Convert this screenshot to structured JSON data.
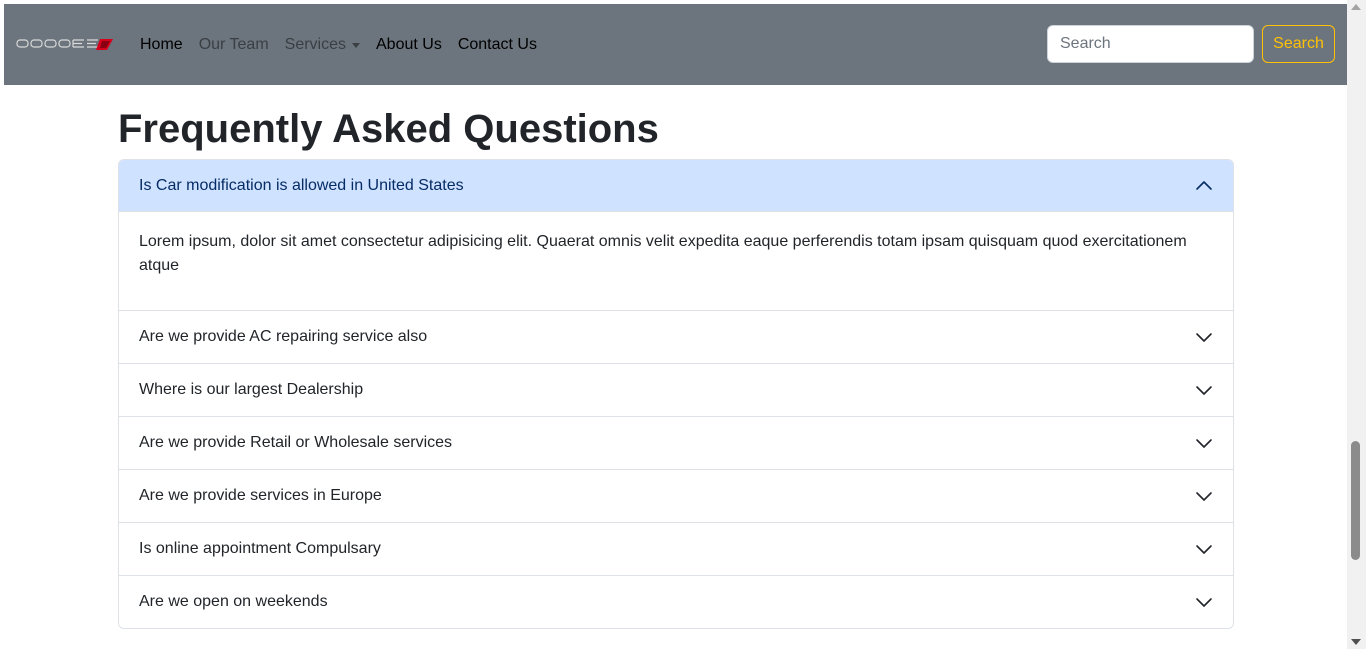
{
  "brand": {
    "logo_text": "DODGE",
    "accent_color": "#d6001c"
  },
  "nav": {
    "links": [
      {
        "label": "Home"
      },
      {
        "label": "Our Team"
      },
      {
        "label": "Services"
      },
      {
        "label": "About Us"
      },
      {
        "label": "Contact Us"
      }
    ]
  },
  "search": {
    "placeholder": "Search",
    "value": "",
    "button_label": "Search"
  },
  "page": {
    "title": "Frequently Asked Questions"
  },
  "faq": {
    "items": [
      {
        "question": "Is Car modification is allowed in United States",
        "answer": "Lorem ipsum, dolor sit amet consectetur adipisicing elit. Quaerat omnis velit expedita eaque perferendis totam ipsam quisquam quod exercitationem atque",
        "expanded": true
      },
      {
        "question": "Are we provide AC repairing service also",
        "expanded": false
      },
      {
        "question": "Where is our largest Dealership",
        "expanded": false
      },
      {
        "question": "Are we provide Retail or Wholesale services",
        "expanded": false
      },
      {
        "question": "Are we provide services in Europe",
        "expanded": false
      },
      {
        "question": "Is online appointment Compulsary",
        "expanded": false
      },
      {
        "question": "Are we open on weekends",
        "expanded": false
      }
    ]
  },
  "colors": {
    "navbar_bg": "#6c757d",
    "accent_warning": "#ffc107",
    "accordion_active_bg": "#cfe2ff",
    "accordion_active_text": "#052c65"
  },
  "icons": {
    "expanded": "chevron-up-icon",
    "collapsed": "chevron-down-icon",
    "caret": "caret-down-icon"
  }
}
